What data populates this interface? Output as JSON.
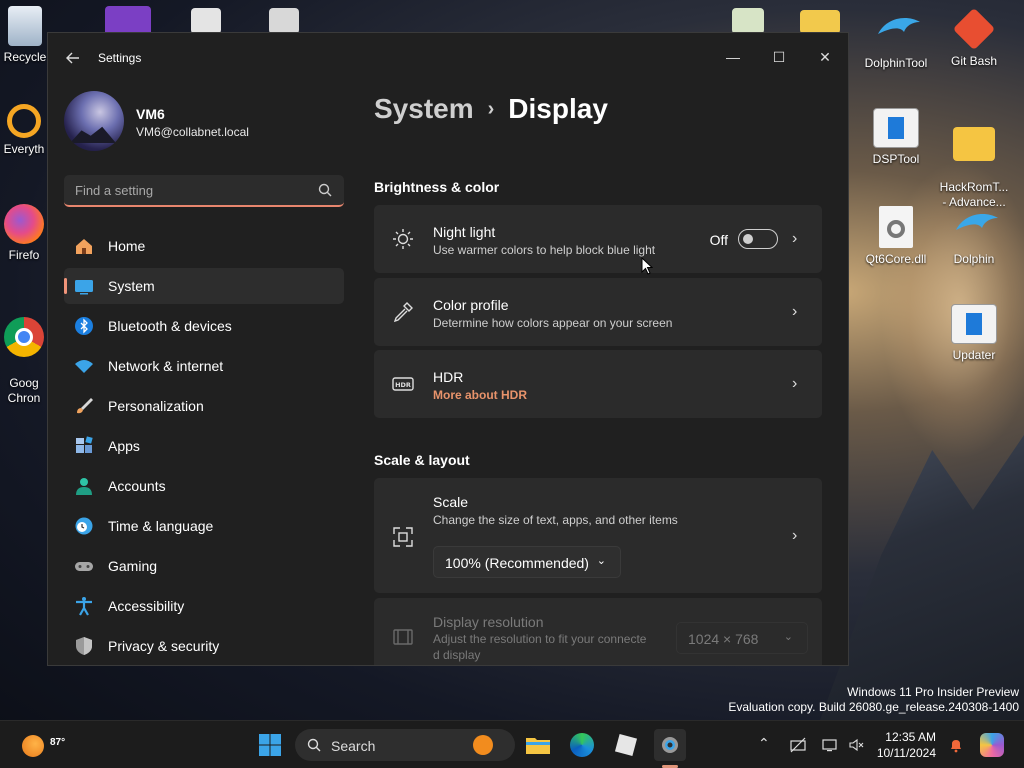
{
  "desktop": {
    "icons_left": [
      {
        "label": "Recycle",
        "icon": "recycle-bin-icon"
      },
      {
        "label": "Everyth",
        "icon": "everything-search-icon"
      },
      {
        "label": "Firefo",
        "icon": "firefox-icon"
      },
      {
        "label": "Goog\nChron",
        "icon": "chrome-icon"
      }
    ],
    "icons_right": [
      {
        "label": "DolphinTool",
        "icon": "dolphin-icon"
      },
      {
        "label": "Git Bash",
        "icon": "git-bash-icon"
      },
      {
        "label": "DSPTool",
        "icon": "window-app-icon"
      },
      {
        "label": "HackRomT...\n- Advance...",
        "icon": "folder-icon"
      },
      {
        "label": "Qt6Core.dll",
        "icon": "dll-file-icon"
      },
      {
        "label": "Dolphin",
        "icon": "dolphin-icon"
      },
      {
        "label": "Updater",
        "icon": "window-app-icon"
      }
    ],
    "watermark_line1": "Windows 11 Pro Insider Preview",
    "watermark_line2": "Evaluation copy. Build 26080.ge_release.240308-1400"
  },
  "window": {
    "title": "Settings",
    "back_icon": "arrow-left-icon",
    "minimize": "—",
    "maximize": "☐",
    "close": "✕"
  },
  "profile": {
    "name": "VM6",
    "email": "VM6@collabnet.local"
  },
  "search": {
    "placeholder": "Find a setting"
  },
  "nav": {
    "items": [
      {
        "label": "Home",
        "icon": "home-icon"
      },
      {
        "label": "System",
        "icon": "system-icon",
        "active": true
      },
      {
        "label": "Bluetooth & devices",
        "icon": "bluetooth-icon"
      },
      {
        "label": "Network & internet",
        "icon": "wifi-icon"
      },
      {
        "label": "Personalization",
        "icon": "brush-icon"
      },
      {
        "label": "Apps",
        "icon": "apps-icon"
      },
      {
        "label": "Accounts",
        "icon": "accounts-icon"
      },
      {
        "label": "Time & language",
        "icon": "clock-globe-icon"
      },
      {
        "label": "Gaming",
        "icon": "gamepad-icon"
      },
      {
        "label": "Accessibility",
        "icon": "accessibility-icon"
      },
      {
        "label": "Privacy & security",
        "icon": "shield-icon"
      }
    ]
  },
  "content": {
    "breadcrumb_parent": "System",
    "breadcrumb_separator": "›",
    "breadcrumb_current": "Display",
    "brightness_section": "Brightness & color",
    "night_light": {
      "title": "Night light",
      "desc": "Use warmer colors to help block blue light",
      "state": "Off"
    },
    "color_profile": {
      "title": "Color profile",
      "desc": "Determine how colors appear on your screen"
    },
    "hdr": {
      "title": "HDR",
      "link": "More about HDR"
    },
    "scale_section": "Scale & layout",
    "scale": {
      "title": "Scale",
      "desc": "Change the size of text, apps, and other items",
      "value": "100% (Recommended)"
    },
    "resolution": {
      "title": "Display resolution",
      "desc_line1": "Adjust the resolution to fit your connecte",
      "desc_line2": "d display",
      "value": "1024 × 768"
    }
  },
  "taskbar": {
    "weather_temp": "87°",
    "search_label": "Search",
    "time": "12:35 AM",
    "date": "10/11/2024",
    "accent": "#e0957a"
  },
  "colors": {
    "window_bg": "#202020",
    "card_bg": "#2b2b2b",
    "accent": "#f09479",
    "link": "#e8936b"
  }
}
